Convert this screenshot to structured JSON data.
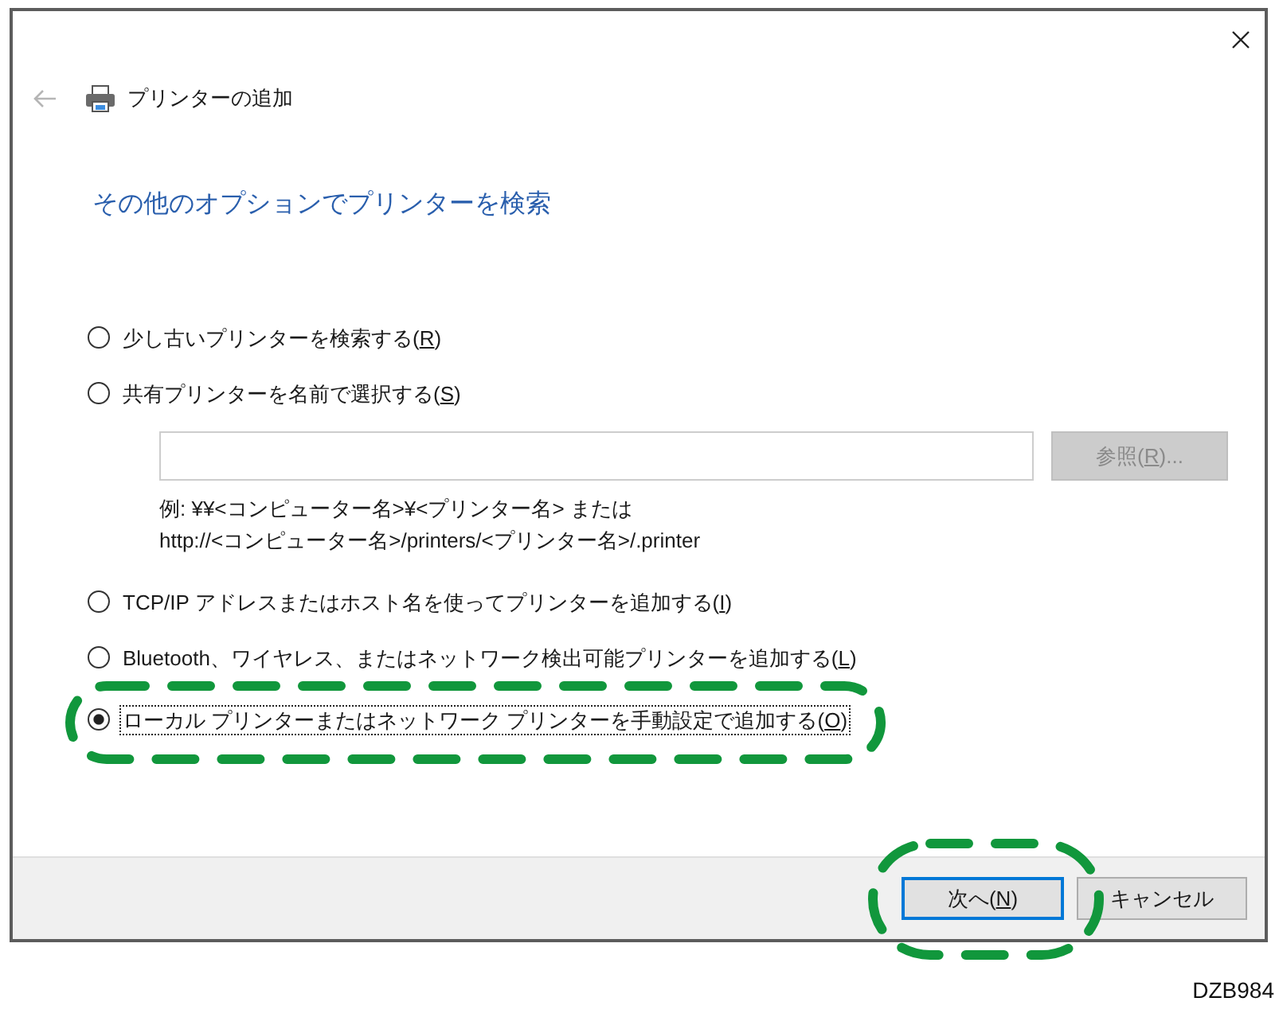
{
  "back_button": {
    "disabled": true
  },
  "header": {
    "title": "プリンターの追加"
  },
  "heading": "その他のオプションでプリンターを検索",
  "options": [
    {
      "text": "少し古いプリンターを検索する(",
      "key": "R",
      "text_end": ")",
      "selected": false,
      "focused": false,
      "highlighted": false
    },
    {
      "text": "共有プリンターを名前で選択する(",
      "key": "S",
      "text_end": ")",
      "selected": false,
      "focused": false,
      "highlighted": false,
      "printer_name_field": {
        "browse_button": {
          "text": "参照(",
          "key": "R",
          "text_end": ")...",
          "disabled": true
        },
        "example": [
          "例: ¥¥<コンピューター名>¥<プリンター名> または",
          "http://<コンピューター名>/printers/<プリンター名>/.printer"
        ]
      }
    },
    {
      "text": "TCP/IP アドレスまたはホスト名を使ってプリンターを追加する(",
      "key": "I",
      "text_end": ")",
      "selected": false,
      "focused": false,
      "highlighted": false
    },
    {
      "text": "Bluetooth、ワイヤレス、またはネットワーク検出可能プリンターを追加する(",
      "key": "L",
      "text_end": ")",
      "selected": false,
      "focused": false,
      "highlighted": false
    },
    {
      "text": "ローカル プリンターまたはネットワーク プリンターを手動設定で追加する(",
      "key": "O",
      "text_end": ")",
      "selected": true,
      "focused": true,
      "highlighted": true
    }
  ],
  "footer_buttons": [
    {
      "text": "次へ(",
      "key": "N",
      "text_end": ")",
      "default": true,
      "highlighted": true
    },
    {
      "text": "キャンセル",
      "default": false,
      "highlighted": false
    }
  ],
  "figure_code": "DZB984"
}
